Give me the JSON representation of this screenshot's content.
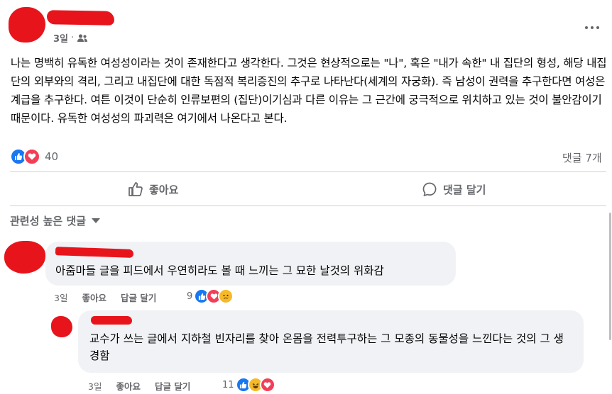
{
  "post": {
    "time": "3일",
    "separator": "·",
    "audience_icon": "friends-icon",
    "more_icon": "more-options-icon",
    "body": "나는 명백히 유독한 여성성이라는 것이 존재한다고 생각한다. 그것은 현상적으로는 \"나\", 혹은 \"내가 속한\" 내 집단의 형성, 해당 내집단의 외부와의 격리, 그리고 내집단에 대한 독점적 복리증진의 추구로 나타난다(세계의 자궁화). 즉 남성이 권력을 추구한다면 여성은 계급을 추구한다. 여튼 이것이 단순히 인류보편의 (집단)이기심과 다른 이유는 그 근간에 궁극적으로 위치하고 있는 것이 불안감이기 때문이다. 유독한 여성성의 파괴력은 여기에서 나온다고 본다.",
    "reaction_count": "40",
    "comment_count": "댓글 7개",
    "like_action": "좋아요",
    "comment_action": "댓글 달기"
  },
  "comments_header": {
    "sort_label": "관련성 높은 댓글",
    "sort_icon": "caret-down-icon"
  },
  "comments": [
    {
      "text": "아줌마들 글을 피드에서 우연히라도 볼 때 느끼는 그 묘한 날것의 위화감",
      "time": "3일",
      "like": "좋아요",
      "reply": "답글 달기",
      "reaction_count": "9",
      "reactions": [
        "like",
        "love",
        "sad"
      ]
    },
    {
      "text": "교수가 쓰는 글에서 지하철 빈자리를 찾아 온몸을 전력투구하는 그 모종의 동물성을 느낀다는 것의 그 생경함",
      "time": "3일",
      "like": "좋아요",
      "reply": "답글 달기",
      "reaction_count": "11",
      "reactions": [
        "like",
        "haha",
        "love"
      ]
    }
  ],
  "colors": {
    "like": "#1877f2",
    "love": "#f33e58",
    "haha": "#f7b928",
    "redaction": "#e8141c"
  }
}
